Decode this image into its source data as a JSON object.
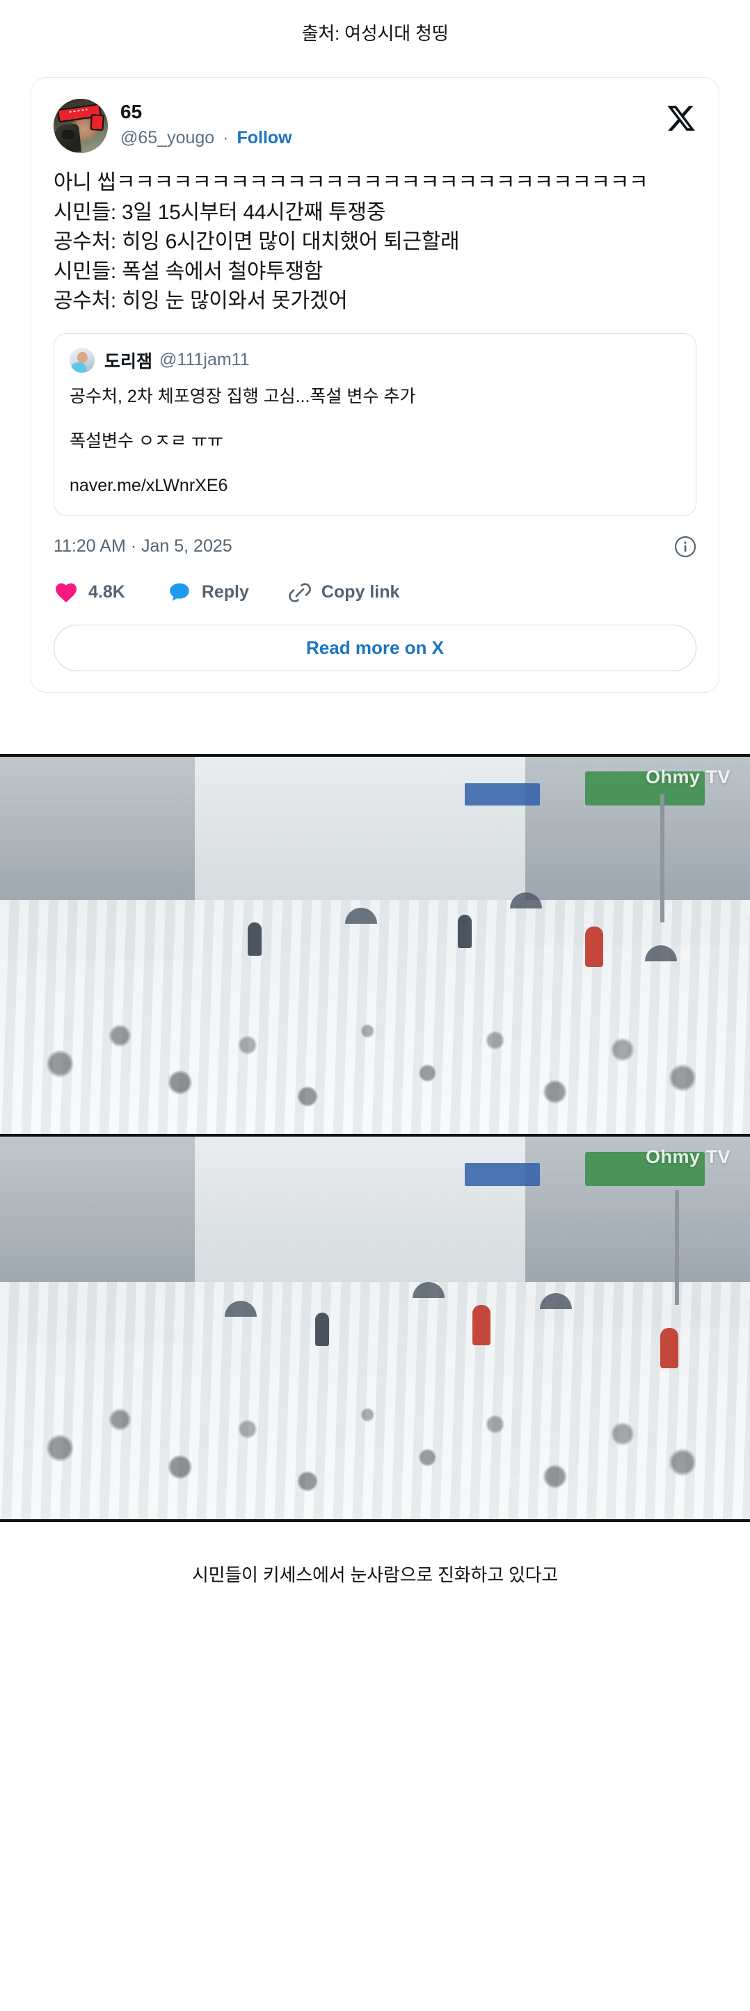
{
  "source_header": "출처: 여성시대 청띵",
  "tweet": {
    "display_name": "65",
    "handle": "@65_yougo",
    "separator": "·",
    "follow_label": "Follow",
    "avatar_name": "user-avatar-soldier-red-headband",
    "logo_name": "x-logo",
    "body_lines": [
      "아니 씹ㅋㅋㅋㅋㅋㅋㅋㅋㅋㅋㅋㅋㅋㅋㅋㅋㅋㅋㅋㅋㅋㅋㅋㅋㅋㅋㅋㅋ",
      "시민들: 3일 15시부터 44시간째 투쟁중",
      "공수처: 히잉 6시간이면 많이 대치했어 퇴근할래",
      "시민들: 폭설 속에서 철야투쟁함",
      "공수처: 히잉 눈 많이와서 못가겠어"
    ],
    "quote": {
      "display_name": "도리잼",
      "handle": "@111jam11",
      "lines": [
        "공수처, 2차 체포영장 집행 고심...폭설 변수 추가",
        "폭설변수 ㅇㅈㄹ ㅠㅠ",
        "naver.me/xLWnrXE6"
      ]
    },
    "timestamp": "11:20 AM · Jan 5, 2025",
    "actions": {
      "like_count": "4.8K",
      "reply_label": "Reply",
      "copy_link_label": "Copy link"
    },
    "read_more_label": "Read more on X"
  },
  "photos": [
    {
      "watermark": "Ohmy TV",
      "alt": "snow-covered protest crowd street view"
    },
    {
      "watermark": "Ohmy TV",
      "alt": "snow-covered protest crowd wider street view"
    }
  ],
  "bottom_caption": "시민들이 키세스에서 눈사람으로 진화하고 있다고",
  "colors": {
    "like_pink": "#F91880",
    "reply_blue": "#1D9BF0",
    "link_blue": "#1B74C4",
    "muted_text": "#536471",
    "body_text": "#0F1419",
    "card_border": "#E6E9EA"
  }
}
